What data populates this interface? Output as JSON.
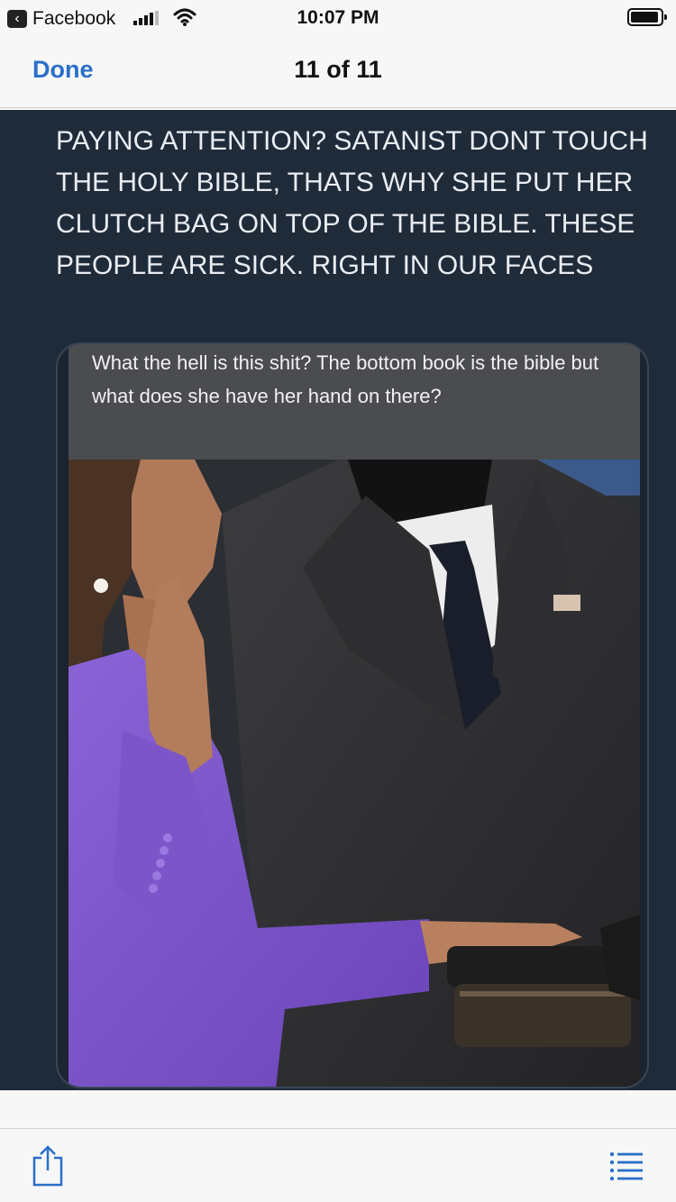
{
  "status_bar": {
    "back_app": "Facebook",
    "time": "10:07 PM"
  },
  "nav": {
    "done_label": "Done",
    "counter": "11 of 11"
  },
  "post": {
    "text": "PAYING ATTENTION? SATANIST DONT TOUCH THE HOLY BIBLE, THATS WHY SHE PUT HER CLUTCH BAG ON TOP OF THE BIBLE. THESE PEOPLE ARE SICK. RIGHT IN OUR FACES"
  },
  "embed": {
    "caption": "What the hell is this shit? The bottom book is the bible but what does she have her hand on there?"
  },
  "colors": {
    "accent": "#2a6fc9",
    "content_bg": "#202b3a",
    "caption_bg": "#4a4c50",
    "suit_purple": "#7a52c9"
  },
  "icons": {
    "share": "share-icon",
    "list": "list-icon"
  }
}
